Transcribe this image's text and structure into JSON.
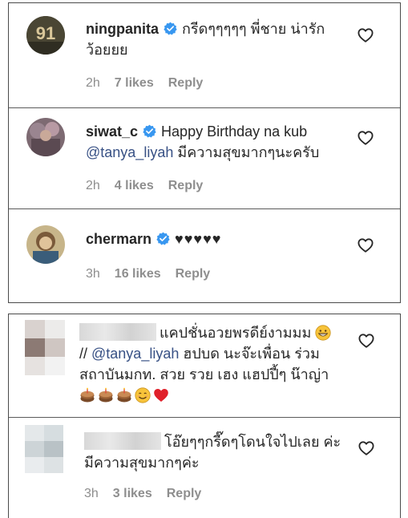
{
  "top_comments": [
    {
      "username": "ningpanita",
      "text": "กรีดๆๆๆๆๆ พี่ชาย น่ารักว้อยยย",
      "time": "2h",
      "likes": "7 likes",
      "reply": "Reply",
      "avatar_label": "91"
    },
    {
      "username": "siwat_c",
      "text_before": "Happy Birthday na kub ",
      "mention": "@tanya_liyah",
      "text_after": " มีความสุขมากๆนะครับ",
      "time": "2h",
      "likes": "4 likes",
      "reply": "Reply"
    },
    {
      "username": "chermarn",
      "text": "♥♥♥♥♥",
      "time": "3h",
      "likes": "16 likes",
      "reply": "Reply"
    }
  ],
  "bottom_comments": [
    {
      "text_before": "แคปชั่นอวยพรดีย์งามมม",
      "text_mid": "// ",
      "mention": "@tanya_liyah",
      "text_after": " ฮปบด นะจ๊ะเพื่อน ร่วมสถาบันมกท. สวย รวย เฮง แฮปปี้ๆ น๊าญ่า"
    },
    {
      "text": "โอ๊ยๆๆกรี๊ดๆโดนใจไปเลย ค่ะ มีความสุขมากๆค่ะ",
      "time": "3h",
      "likes": "3 likes",
      "reply": "Reply"
    }
  ],
  "colors": {
    "text": "#262626",
    "meta": "#8e8e8e",
    "mention": "#385185",
    "verified": "#3897f0",
    "border": "#4a4a4a"
  }
}
